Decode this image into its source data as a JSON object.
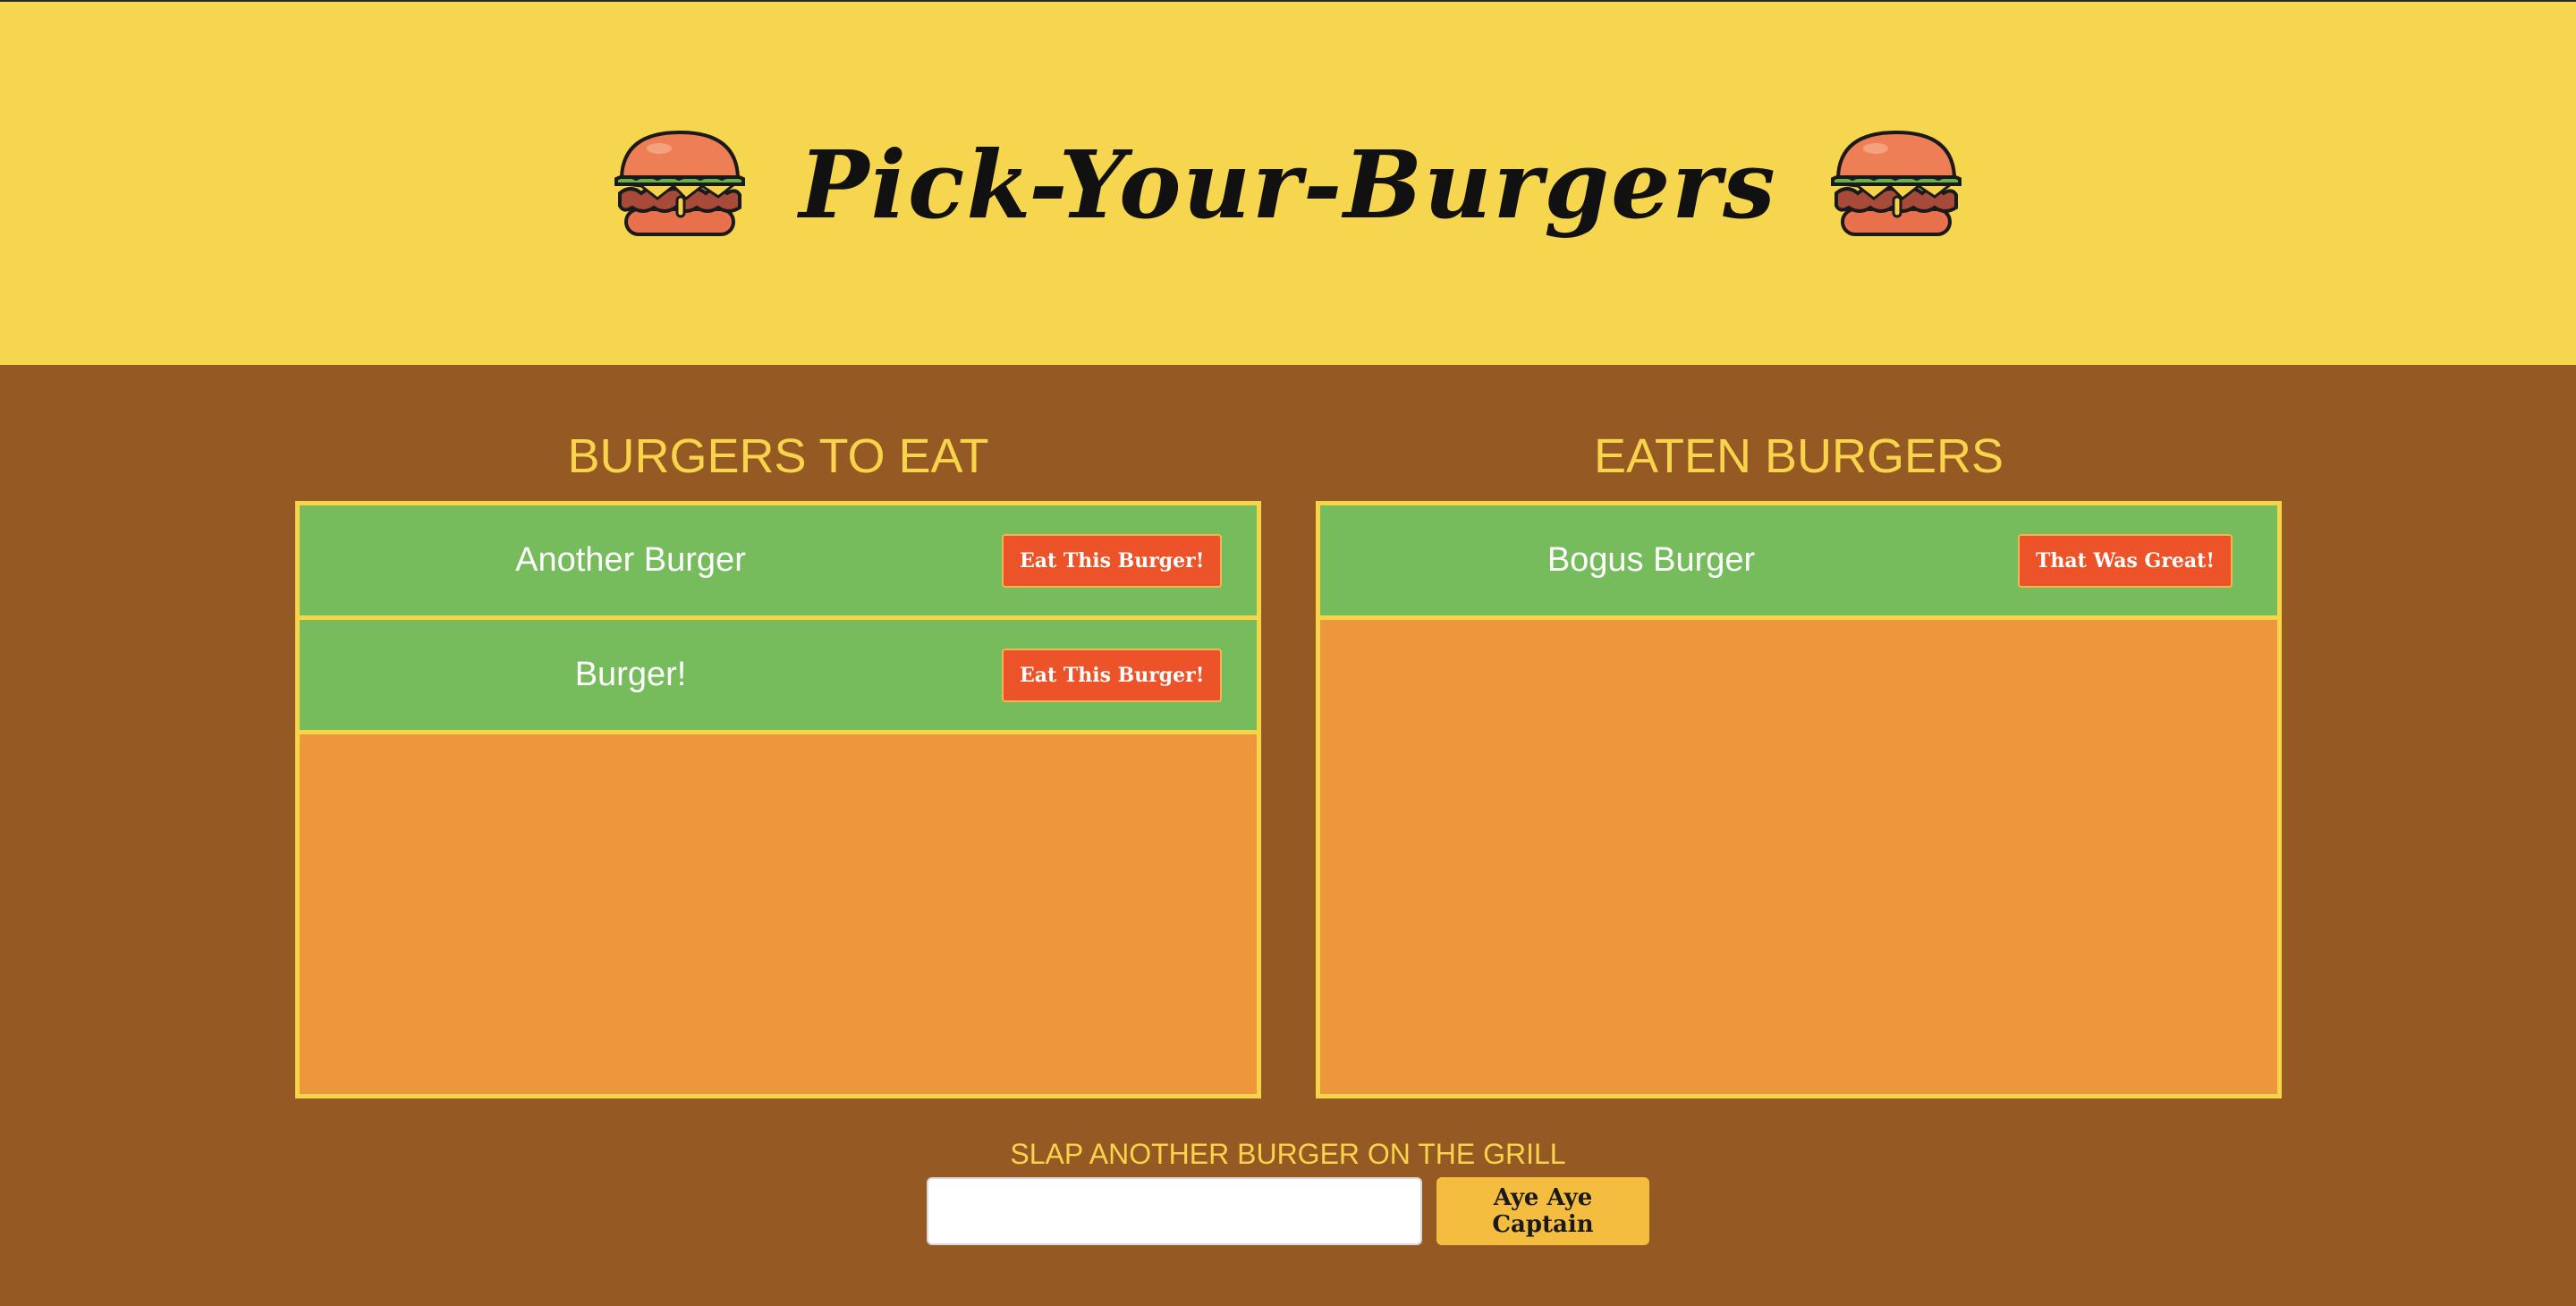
{
  "header": {
    "title": "Pick-Your-Burgers",
    "icon": "burger-icon"
  },
  "to_eat": {
    "heading": "BURGERS TO EAT",
    "items": [
      {
        "name": "Another Burger",
        "button_label": "Eat This Burger!"
      },
      {
        "name": "Burger!",
        "button_label": "Eat This Burger!"
      }
    ]
  },
  "eaten": {
    "heading": "EATEN BURGERS",
    "items": [
      {
        "name": "Bogus Burger",
        "button_label": "That Was Great!"
      }
    ]
  },
  "form": {
    "label": "SLAP ANOTHER BURGER ON THE GRILL",
    "input_value": "",
    "submit_label": "Aye Aye Captain"
  },
  "colors": {
    "header_bg": "#f7d64f",
    "page_bg": "#955924",
    "accent_yellow": "#f8d44b",
    "row_green": "#76bc5d",
    "box_orange": "#ee963b",
    "button_red": "#ec5328",
    "submit_yellow": "#f5bd3f"
  }
}
